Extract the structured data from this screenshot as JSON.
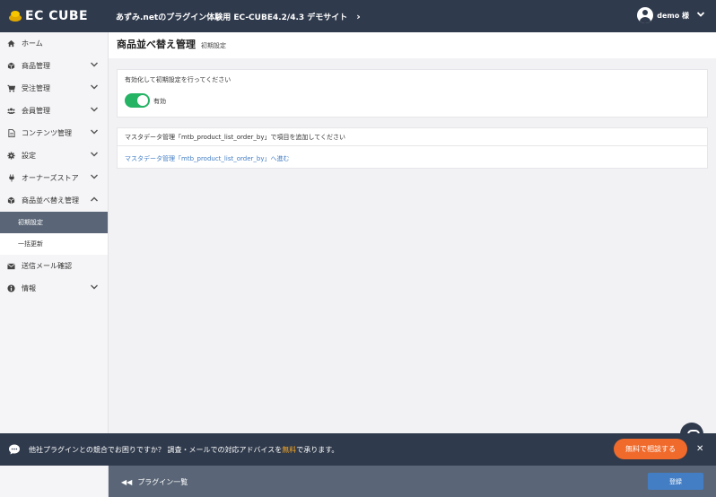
{
  "header": {
    "logo_text": "EC CUBE",
    "site_title": "あずみ.netのプラグイン体験用 EC-CUBE4.2/4.3 デモサイト",
    "site_chevron": "›",
    "user_name": "demo 様",
    "user_chevron": "⌄"
  },
  "sidebar": {
    "items": [
      {
        "label": "ホーム"
      },
      {
        "label": "商品管理"
      },
      {
        "label": "受注管理"
      },
      {
        "label": "会員管理"
      },
      {
        "label": "コンテンツ管理"
      },
      {
        "label": "設定"
      },
      {
        "label": "オーナーズストア"
      },
      {
        "label": "商品並べ替え管理"
      },
      {
        "label": "送信メール確認"
      },
      {
        "label": "情報"
      }
    ],
    "sub_items": [
      {
        "label": "初期設定"
      },
      {
        "label": "一括更新"
      }
    ]
  },
  "page": {
    "title": "商品並べ替え管理",
    "subtitle": "初期設定"
  },
  "init_card": {
    "label": "有効化して初期設定を行ってください",
    "toggle_label": "有効",
    "toggle_on": true,
    "toggle_color": "#25b364"
  },
  "master_card": {
    "header": "マスタデータ管理「mtb_product_list_order_by」で項目を追加してください",
    "link": "マスタデータ管理「mtb_product_list_order_by」へ進む"
  },
  "footer": {
    "back_label": "プラグイン一覧",
    "back_icon": "◀◀",
    "register_label": "登録"
  },
  "promo": {
    "text_before": "他社プラグインとの競合でお困りですか？ 調査・メールでの対応アドバイスを",
    "text_highlight": "無料",
    "text_after": "で承ります。",
    "button_label": "無料で相談する",
    "close": "✕"
  },
  "colors": {
    "header_bg": "#2f3a4c",
    "accent_blue": "#437ec4",
    "promo_button": "#f06a2b"
  }
}
